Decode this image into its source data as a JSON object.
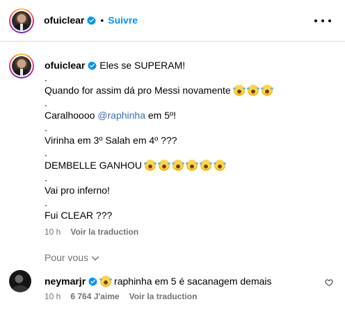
{
  "post": {
    "username": "ofuiclear",
    "dot": "•",
    "follow_label": "Suivre",
    "more_icon": "more-horizontal-icon"
  },
  "caption": {
    "username": "ofuiclear",
    "lines": [
      "Eles se SUPERAM!",
      ".",
      "Quando for assim dá pro Messi novamente",
      ".",
      "Caralhoooo",
      ".",
      "Virinha em 3º Salah em 4º ???",
      ".",
      "DEMBELLE GANHOU",
      ".",
      "Vai pro inferno!",
      ".",
      "Fui CLEAR ???"
    ],
    "mention": "@raphinha",
    "mention_suffix": " em 5º!",
    "time": "10 h",
    "translate_label": "Voir la traduction"
  },
  "sort": {
    "label": "Pour vous"
  },
  "comment": {
    "username": "neymarjr",
    "text": "raphinha em 5 é sacanagem demais",
    "time": "10 h",
    "likes": "6 764 J'aime",
    "translate_label": "Voir la traduction"
  },
  "colors": {
    "accent": "#0095f6",
    "muted": "#737373",
    "verified": "#0095f6"
  }
}
